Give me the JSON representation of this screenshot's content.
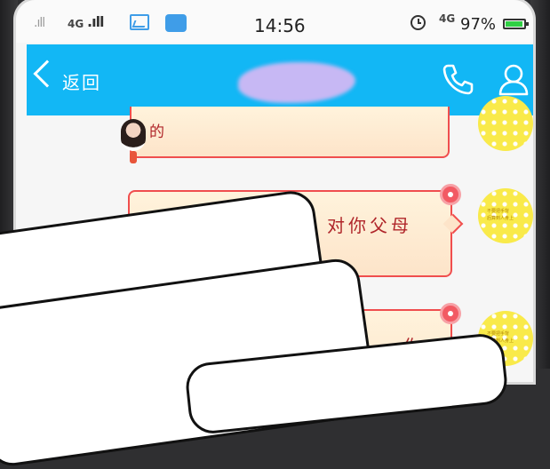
{
  "status_bar": {
    "network_left": "4G",
    "time": "14:56",
    "network_right": "4G",
    "battery": "97%",
    "icons": [
      "signal-icon",
      "signal-icon",
      "gallery-icon",
      "app-icon",
      "alarm-icon",
      "battery-icon"
    ]
  },
  "titlebar": {
    "back_label": "返回",
    "icons": [
      "back-chevron-icon",
      "phone-call-icon",
      "contact-profile-icon"
    ],
    "colors": {
      "accent": "#12b7f5"
    }
  },
  "messages": [
    {
      "side": "left",
      "text": "的"
    },
    {
      "side": "right",
      "text": "对你父母"
    },
    {
      "side": "right",
      "text": "你"
    }
  ],
  "avatar_right": {
    "lines": [
      "不要把手背",
      "后算到人身上"
    ]
  },
  "colors": {
    "bubble_border": "#f04e4e",
    "bubble_text": "#b0262a",
    "avatar_yellow": "#f9ea4a"
  }
}
